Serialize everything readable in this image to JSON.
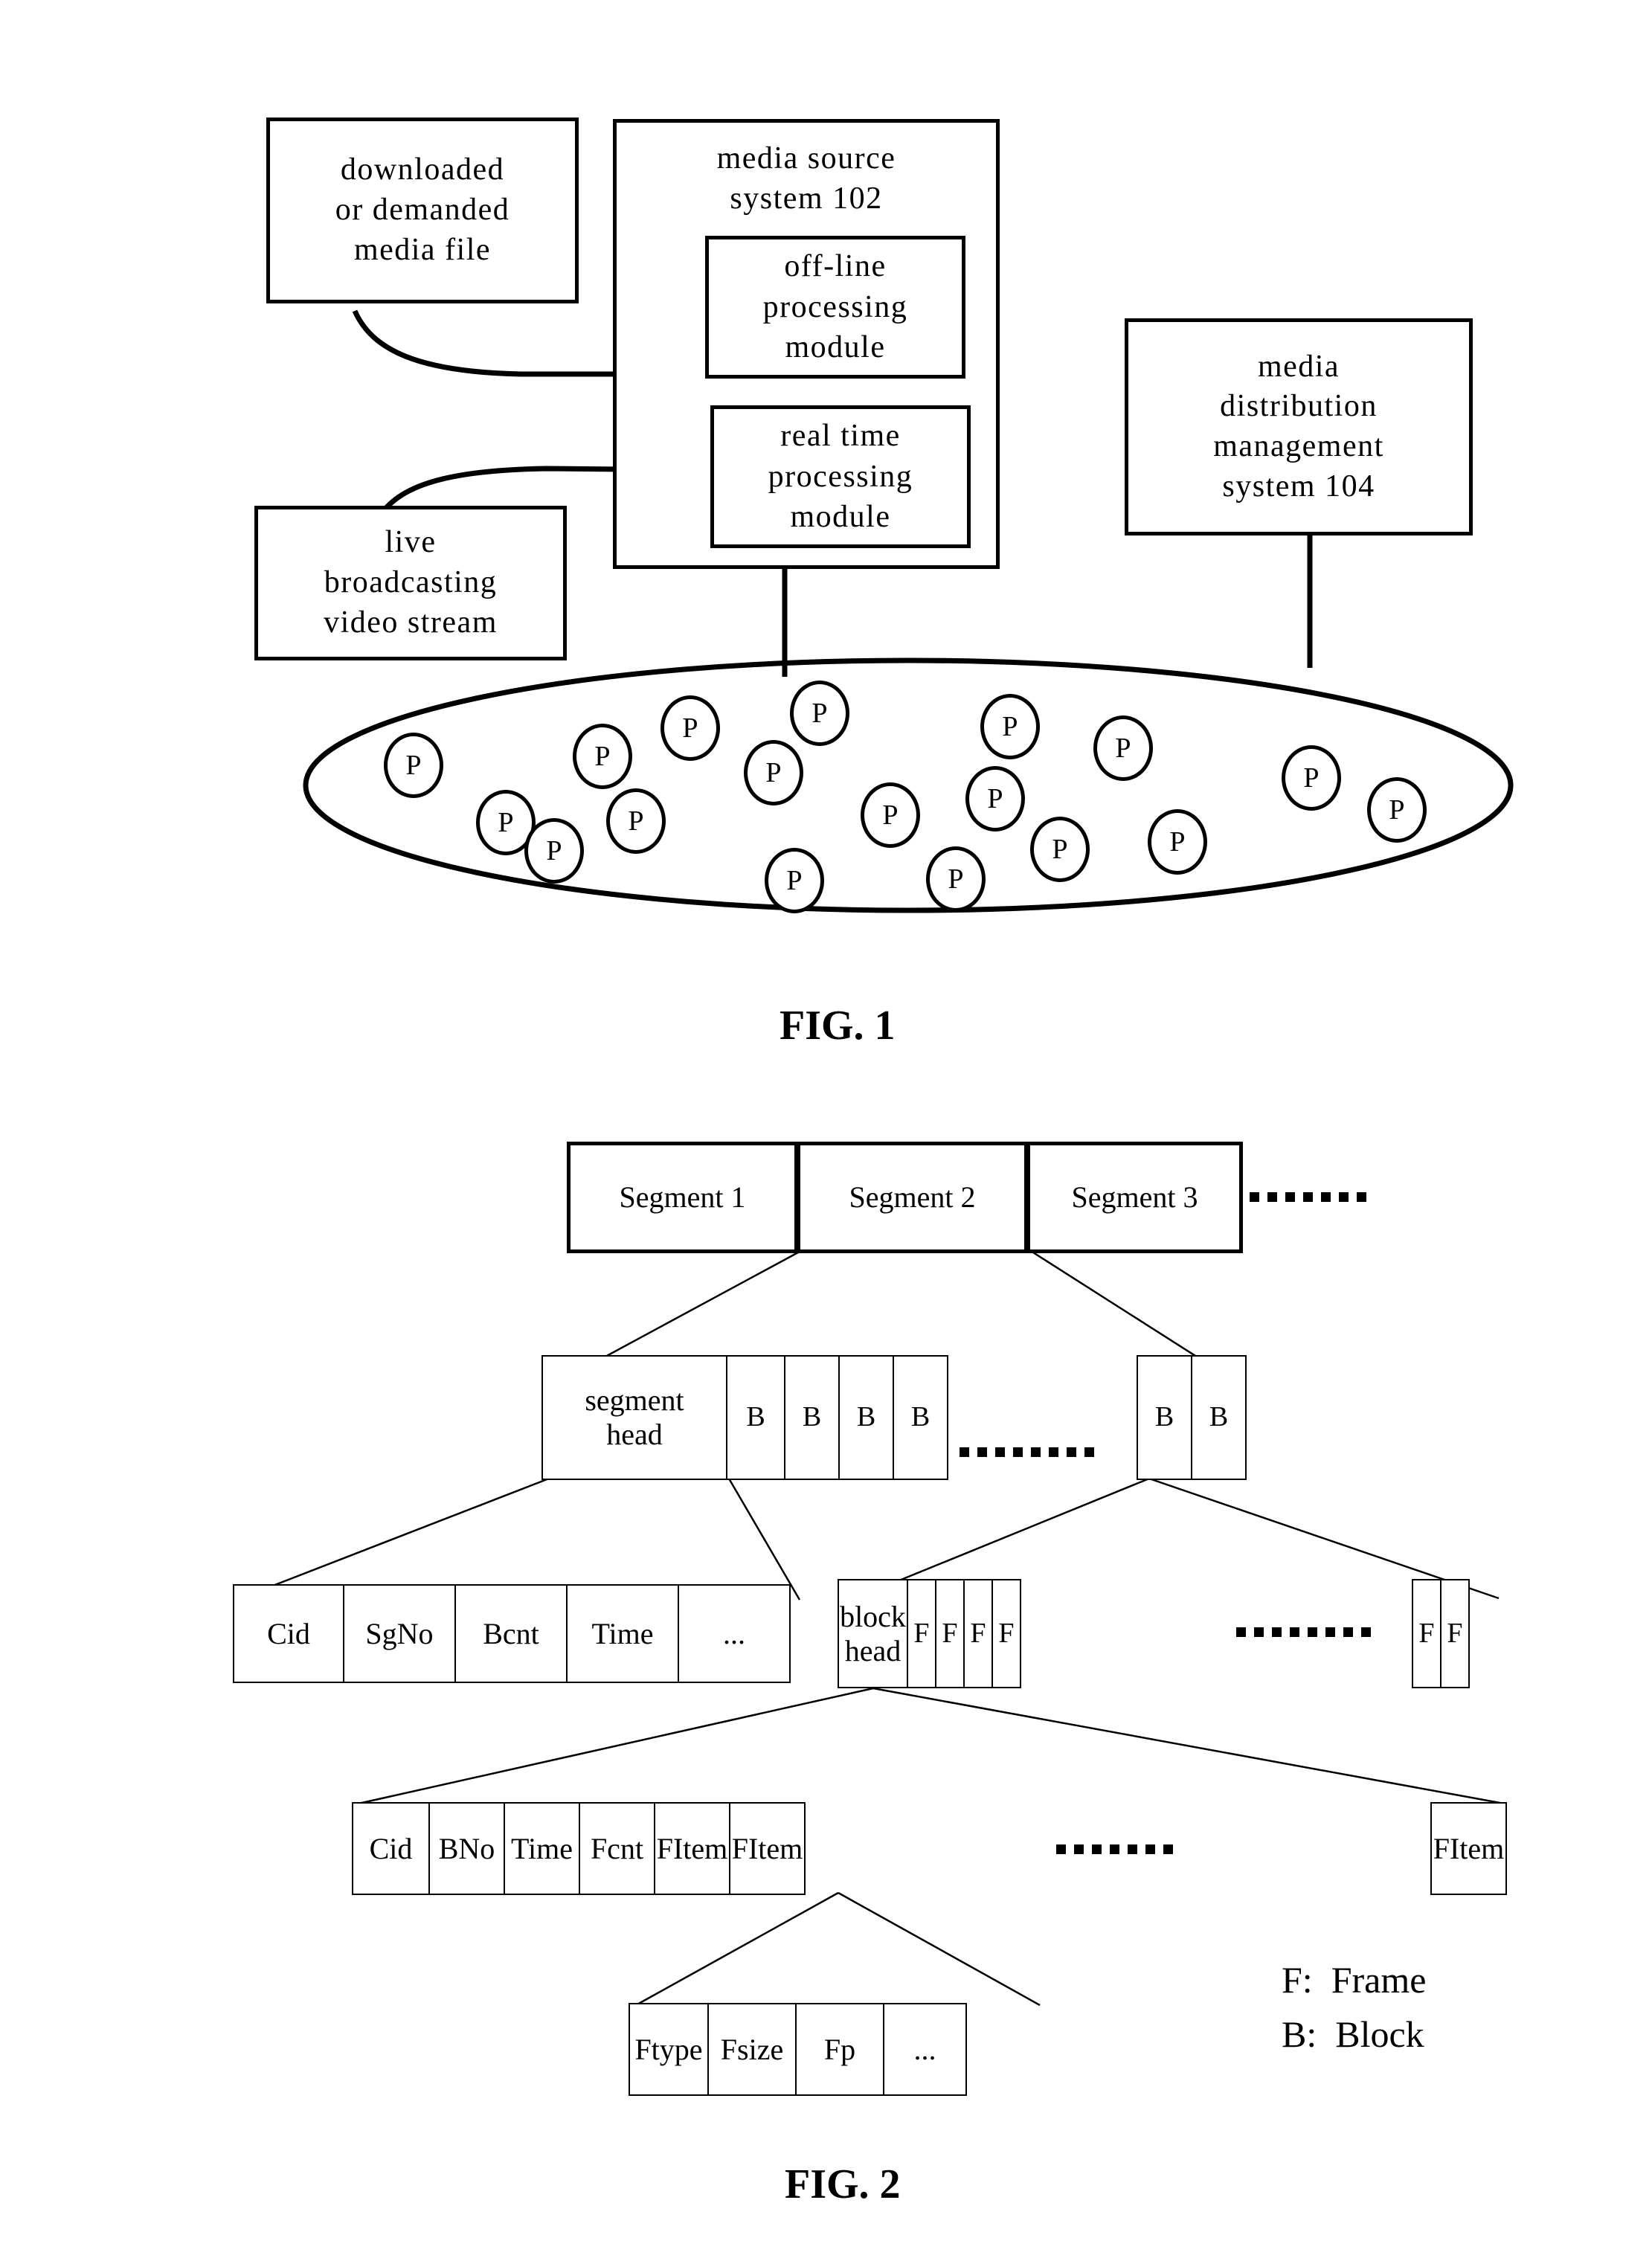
{
  "figure1": {
    "caption": "FIG. 1",
    "boxes": {
      "downloaded_media": {
        "lines": [
          "downloaded",
          "or demanded",
          "media file"
        ]
      },
      "live_stream": {
        "lines": [
          "live",
          "broadcasting",
          "video stream"
        ]
      },
      "media_source_system": {
        "lines": [
          "media source",
          "system 102"
        ]
      },
      "offline_module": {
        "lines": [
          "off-line",
          "processing",
          "module"
        ]
      },
      "realtime_module": {
        "lines": [
          "real time",
          "processing",
          "module"
        ]
      },
      "media_distribution": {
        "lines": [
          "media",
          "distribution",
          "management",
          "system   104"
        ]
      }
    },
    "peer_label": "P",
    "peer_count": 18
  },
  "figure2": {
    "caption": "FIG. 2",
    "segment_row": {
      "cells": [
        "Segment 1",
        "Segment 2",
        "Segment 3"
      ],
      "continuation": "dashed"
    },
    "segment_detail_row": {
      "head": [
        "segment",
        "head"
      ],
      "blocks": [
        "B",
        "B",
        "B",
        "B"
      ],
      "tail_blocks": [
        "B",
        "B"
      ]
    },
    "segment_head_fields": {
      "cells": [
        "Cid",
        "SgNo",
        "Bcnt",
        "Time",
        "..."
      ]
    },
    "block_detail_row": {
      "head": [
        "block",
        "head"
      ],
      "frames": [
        "F",
        "F",
        "F",
        "F"
      ],
      "tail_frames": [
        "F",
        "F"
      ]
    },
    "block_head_fields": {
      "cells": [
        "Cid",
        "BNo",
        "Time",
        "Fcnt",
        "FItem",
        "FItem"
      ],
      "tail_cells": [
        "FItem"
      ]
    },
    "fitem_fields": {
      "cells": [
        "Ftype",
        "Fsize",
        "Fp",
        "..."
      ]
    },
    "legend": {
      "frame": "F:  Frame",
      "block": "B:  Block"
    }
  },
  "colors": {
    "stroke": "#000000",
    "background": "#ffffff"
  }
}
